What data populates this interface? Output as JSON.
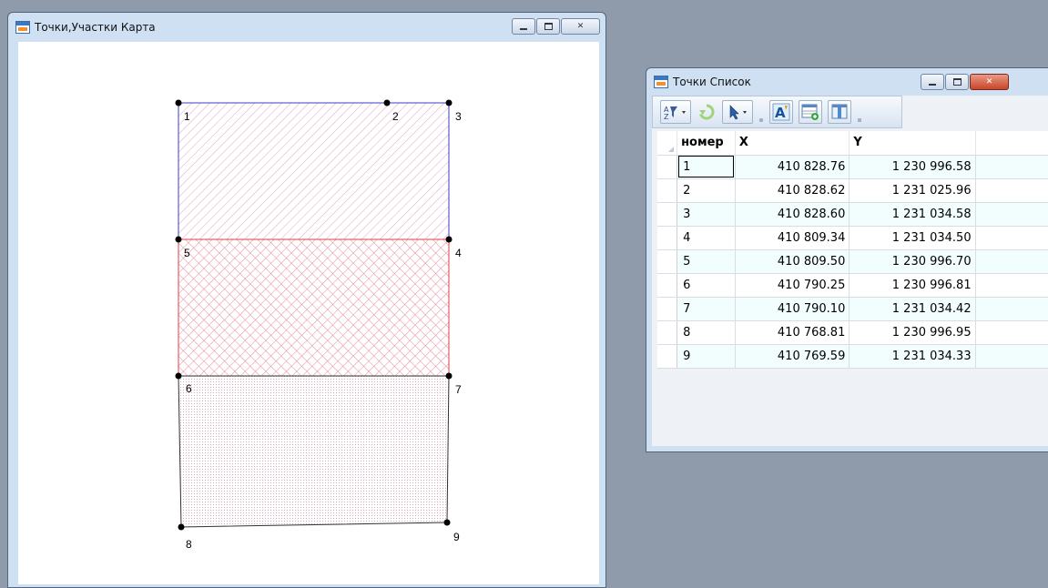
{
  "map_window": {
    "title": "Точки,Участки Карта",
    "points": [
      {
        "label": "1"
      },
      {
        "label": "2"
      },
      {
        "label": "3"
      },
      {
        "label": "4"
      },
      {
        "label": "5"
      },
      {
        "label": "6"
      },
      {
        "label": "7"
      },
      {
        "label": "8"
      },
      {
        "label": "9"
      }
    ]
  },
  "list_window": {
    "title": "Точки Список",
    "columns": [
      "номер",
      "X",
      "Y"
    ],
    "rows": [
      {
        "num": "1",
        "x": "410 828.76",
        "y": "1 230 996.58"
      },
      {
        "num": "2",
        "x": "410 828.62",
        "y": "1 231 025.96"
      },
      {
        "num": "3",
        "x": "410 828.60",
        "y": "1 231 034.58"
      },
      {
        "num": "4",
        "x": "410 809.34",
        "y": "1 231 034.50"
      },
      {
        "num": "5",
        "x": "410 809.50",
        "y": "1 230 996.70"
      },
      {
        "num": "6",
        "x": "410 790.25",
        "y": "1 230 996.81"
      },
      {
        "num": "7",
        "x": "410 790.10",
        "y": "1 231 034.42"
      },
      {
        "num": "8",
        "x": "410 768.81",
        "y": "1 230 996.95"
      },
      {
        "num": "9",
        "x": "410 769.59",
        "y": "1 231 034.33"
      }
    ]
  },
  "colors": {
    "parcel_top": "#3c3cc8",
    "parcel_middle": "#e04040",
    "parcel_bottom": "#333333",
    "hatch": "#e8a8c8"
  },
  "icons": {
    "window": "window-app-icon",
    "toolbar": [
      "sort-filter-icon",
      "refresh-icon",
      "select-arrow-icon",
      "text-style-icon",
      "add-row-icon",
      "columns-icon"
    ]
  }
}
